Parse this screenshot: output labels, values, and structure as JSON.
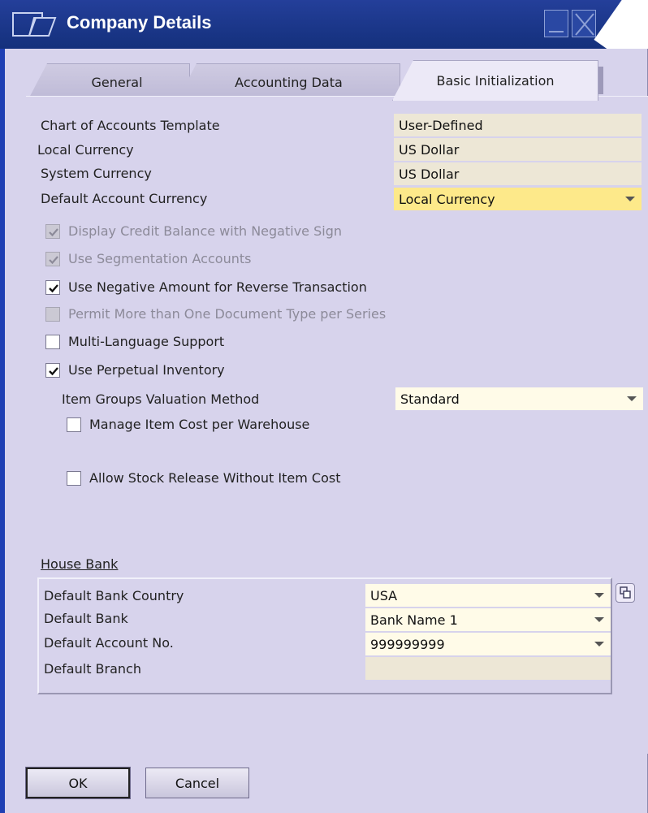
{
  "window": {
    "title": "Company Details",
    "colors": {
      "titlebar": "#1b3a8f",
      "panel": "#d7d3ec",
      "highlight": "#fde98a"
    }
  },
  "tabs": [
    {
      "label": "General",
      "active": false
    },
    {
      "label": "Accounting Data",
      "active": false
    },
    {
      "label": "Basic Initialization",
      "active": true
    }
  ],
  "fields": {
    "chart_template": {
      "label": "Chart of Accounts Template",
      "value": "User-Defined"
    },
    "local_currency": {
      "label": "Local Currency",
      "value": "US Dollar"
    },
    "system_currency": {
      "label": "System Currency",
      "value": "US Dollar"
    },
    "default_account_currency": {
      "label": "Default Account Currency",
      "value": "Local Currency"
    }
  },
  "checkboxes": {
    "display_credit": {
      "label": "Display Credit Balance with Negative Sign",
      "checked": true,
      "enabled": false
    },
    "segmentation": {
      "label": "Use Segmentation Accounts",
      "checked": true,
      "enabled": false
    },
    "negative_amount": {
      "label": "Use Negative Amount for Reverse Transaction",
      "checked": true,
      "enabled": true
    },
    "permit_more": {
      "label": "Permit More than One Document Type per Series",
      "checked": false,
      "enabled": false
    },
    "multi_language": {
      "label": "Multi-Language Support",
      "checked": false,
      "enabled": true
    },
    "perpetual": {
      "label": "Use Perpetual Inventory",
      "checked": true,
      "enabled": true
    },
    "manage_cost": {
      "label": "Manage Item Cost per Warehouse",
      "checked": false,
      "enabled": true
    },
    "allow_stock": {
      "label": "Allow Stock Release Without Item Cost",
      "checked": false,
      "enabled": true
    }
  },
  "valuation": {
    "label": "Item Groups Valuation Method",
    "value": "Standard"
  },
  "house_bank": {
    "title": "House Bank",
    "rows": [
      {
        "label": "Default Bank Country",
        "value": "USA"
      },
      {
        "label": "Default Bank",
        "value": "Bank Name 1"
      },
      {
        "label": "Default Account No.",
        "value": "999999999"
      },
      {
        "label": "Default Branch",
        "value": ""
      }
    ]
  },
  "buttons": {
    "ok": "OK",
    "cancel": "Cancel"
  }
}
